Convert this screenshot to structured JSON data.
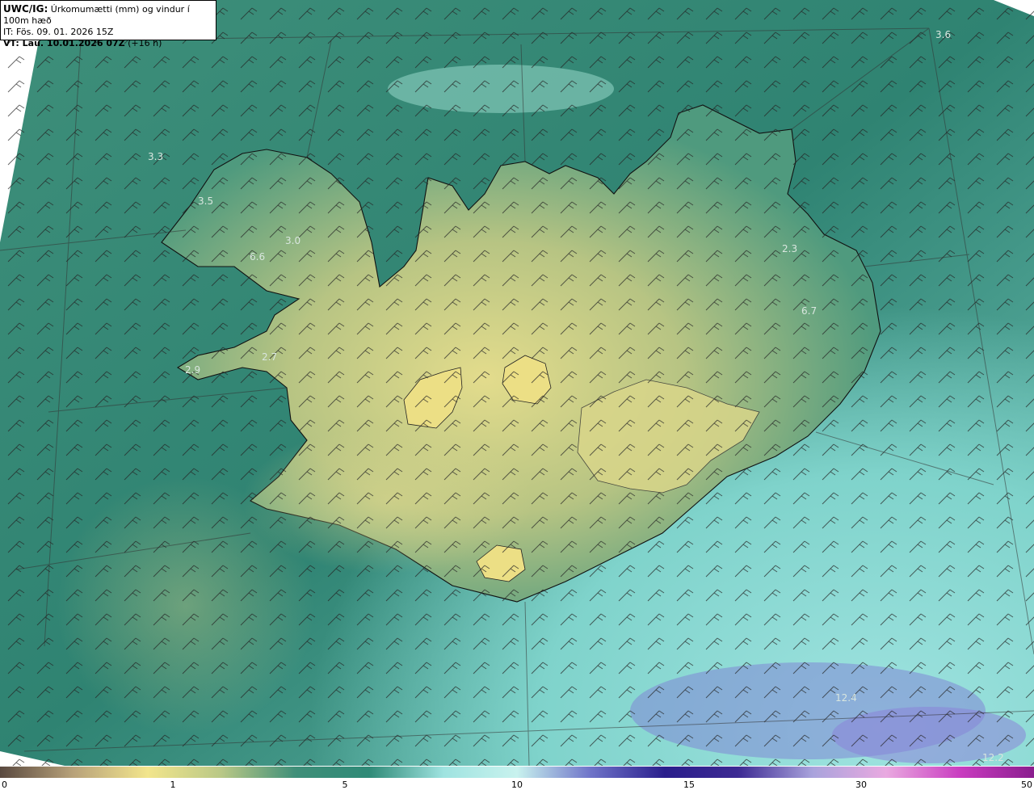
{
  "header": {
    "model": "UWC/IG:",
    "title": "Úrkomumætti (mm) og vindur í 100m hæð",
    "init_time": "IT: Fös. 09. 01. 2026 15Z",
    "valid_label": "VT: Lau. 10.01.2026 07Z",
    "valid_offset": "(+16 h)"
  },
  "colorbar": {
    "ticks": [
      "0",
      "1",
      "5",
      "10",
      "15",
      "30",
      "50"
    ],
    "colors": [
      "#5a4a40",
      "#b8a27a",
      "#f2e58c",
      "#b9c886",
      "#3f8f79",
      "#2f8a77",
      "#9fe3e0",
      "#c8f2ee",
      "#6f74c9",
      "#2a1e8c",
      "#3d2a93",
      "#a9a3dc",
      "#e9a9e0",
      "#c93cc0",
      "#8a1d8e"
    ]
  },
  "stations": [
    {
      "label": "3.6"
    },
    {
      "label": "3.5"
    },
    {
      "label": "3.0"
    },
    {
      "label": "6.6"
    },
    {
      "label": "2.7"
    },
    {
      "label": "3.3"
    },
    {
      "label": "2.3"
    },
    {
      "label": "6.7"
    },
    {
      "label": "2.9"
    },
    {
      "label": "12.4"
    },
    {
      "label": "12.2"
    }
  ]
}
